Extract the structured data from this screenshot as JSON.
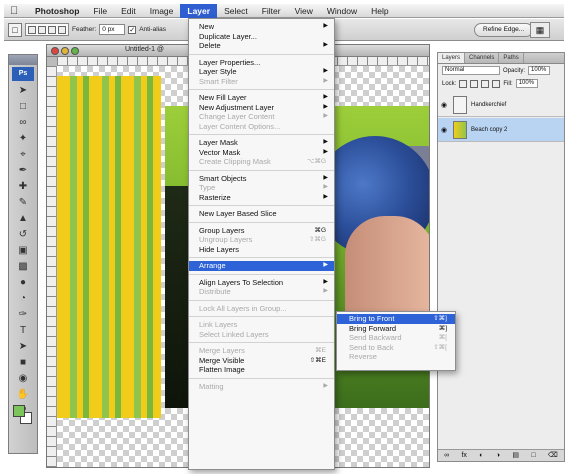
{
  "menubar": {
    "items": [
      "Photoshop",
      "File",
      "Edit",
      "Image",
      "Layer",
      "Select",
      "Filter",
      "View",
      "Window",
      "Help"
    ],
    "active": "Layer"
  },
  "options": {
    "feather_label": "Feather:",
    "feather_value": "0 px",
    "antialias_label": "Anti-alias",
    "refine_edge": "Refine Edge..."
  },
  "document": {
    "title": "Untitled-1 @"
  },
  "layers_panel": {
    "tabs": [
      "Layers",
      "Channels",
      "Paths"
    ],
    "blend_mode": "Normal",
    "opacity_label": "Opacity:",
    "opacity_value": "100%",
    "lock_label": "Lock:",
    "fill_label": "Fill:",
    "fill_value": "100%",
    "layers": [
      {
        "name": "Handkerchief",
        "selected": false
      },
      {
        "name": "Beach copy 2",
        "selected": true
      }
    ]
  },
  "layer_menu": {
    "items": [
      {
        "label": "New",
        "arrow": true
      },
      {
        "label": "Duplicate Layer..."
      },
      {
        "label": "Delete",
        "arrow": true
      },
      {
        "sep": true
      },
      {
        "label": "Layer Properties..."
      },
      {
        "label": "Layer Style",
        "arrow": true
      },
      {
        "label": "Smart Filter",
        "arrow": true,
        "disabled": true
      },
      {
        "sep": true
      },
      {
        "label": "New Fill Layer",
        "arrow": true
      },
      {
        "label": "New Adjustment Layer",
        "arrow": true
      },
      {
        "label": "Change Layer Content",
        "arrow": true,
        "disabled": true
      },
      {
        "label": "Layer Content Options...",
        "disabled": true
      },
      {
        "sep": true
      },
      {
        "label": "Layer Mask",
        "arrow": true
      },
      {
        "label": "Vector Mask",
        "arrow": true
      },
      {
        "label": "Create Clipping Mask",
        "shortcut": "⌥⌘G",
        "disabled": true
      },
      {
        "sep": true
      },
      {
        "label": "Smart Objects",
        "arrow": true
      },
      {
        "label": "Type",
        "arrow": true,
        "disabled": true
      },
      {
        "label": "Rasterize",
        "arrow": true
      },
      {
        "sep": true
      },
      {
        "label": "New Layer Based Slice"
      },
      {
        "sep": true
      },
      {
        "label": "Group Layers",
        "shortcut": "⌘G"
      },
      {
        "label": "Ungroup Layers",
        "shortcut": "⇧⌘G",
        "disabled": true
      },
      {
        "label": "Hide Layers"
      },
      {
        "sep": true
      },
      {
        "label": "Arrange",
        "arrow": true,
        "highlighted": true
      },
      {
        "sep": true
      },
      {
        "label": "Align Layers To Selection",
        "arrow": true
      },
      {
        "label": "Distribute",
        "arrow": true,
        "disabled": true
      },
      {
        "sep": true
      },
      {
        "label": "Lock All Layers in Group...",
        "disabled": true
      },
      {
        "sep": true
      },
      {
        "label": "Link Layers",
        "disabled": true
      },
      {
        "label": "Select Linked Layers",
        "disabled": true
      },
      {
        "sep": true
      },
      {
        "label": "Merge Layers",
        "shortcut": "⌘E",
        "disabled": true
      },
      {
        "label": "Merge Visible",
        "shortcut": "⇧⌘E"
      },
      {
        "label": "Flatten Image"
      },
      {
        "sep": true
      },
      {
        "label": "Matting",
        "arrow": true,
        "disabled": true
      }
    ]
  },
  "arrange_menu": {
    "items": [
      {
        "label": "Bring to Front",
        "shortcut": "⇧⌘]",
        "highlighted": true
      },
      {
        "label": "Bring Forward",
        "shortcut": "⌘]"
      },
      {
        "label": "Send Backward",
        "shortcut": "⌘[",
        "disabled": true
      },
      {
        "label": "Send to Back",
        "shortcut": "⇧⌘[",
        "disabled": true
      },
      {
        "label": "Reverse",
        "disabled": true
      }
    ]
  },
  "colors": {
    "menu_highlight": "#2d63d6",
    "foreground_swatch": "#7bc55a"
  }
}
